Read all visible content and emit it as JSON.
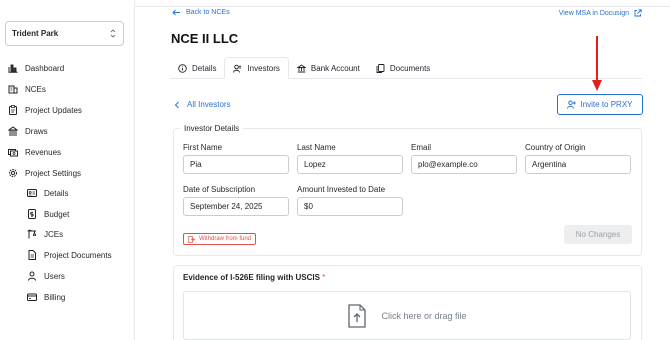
{
  "project": {
    "name": "Trident Park"
  },
  "sidebar": {
    "items": [
      {
        "label": "Dashboard"
      },
      {
        "label": "NCEs"
      },
      {
        "label": "Project Updates"
      },
      {
        "label": "Draws"
      },
      {
        "label": "Revenues"
      },
      {
        "label": "Project Settings"
      }
    ],
    "sub_items": [
      {
        "label": "Details"
      },
      {
        "label": "Budget"
      },
      {
        "label": "JCEs"
      },
      {
        "label": "Project Documents"
      },
      {
        "label": "Users"
      },
      {
        "label": "Billing"
      }
    ]
  },
  "header": {
    "back_label": "Back to NCEs",
    "msa_label": "View MSA in Docusign",
    "title": "NCE II LLC"
  },
  "tabs": [
    {
      "label": "Details",
      "active": false
    },
    {
      "label": "Investors",
      "active": true
    },
    {
      "label": "Bank Account",
      "active": false
    },
    {
      "label": "Documents",
      "active": false
    }
  ],
  "investors": {
    "all_label": "All Investors",
    "invite_label": "Invite to PRXY"
  },
  "investor_details": {
    "legend": "Investor Details",
    "first_name": {
      "label": "First Name",
      "value": "Pia"
    },
    "last_name": {
      "label": "Last Name",
      "value": "Lopez"
    },
    "email": {
      "label": "Email",
      "value": "plo@example.co"
    },
    "country": {
      "label": "Country of Origin",
      "value": "Argentina"
    },
    "subscription_date": {
      "label": "Date of Subscription",
      "value": "September 24, 2025"
    },
    "amount": {
      "label": "Amount Invested to Date",
      "value": "$0"
    },
    "withdraw_label": "Withdraw from fund",
    "no_changes_label": "No Changes"
  },
  "evidence": {
    "label": "Evidence of I-526E filing with USCIS",
    "required_mark": "*",
    "dropzone_text": "Click here or drag file"
  },
  "colors": {
    "link": "#2a6fd4",
    "danger": "#e2504c",
    "annotation_arrow": "#e0201b"
  }
}
